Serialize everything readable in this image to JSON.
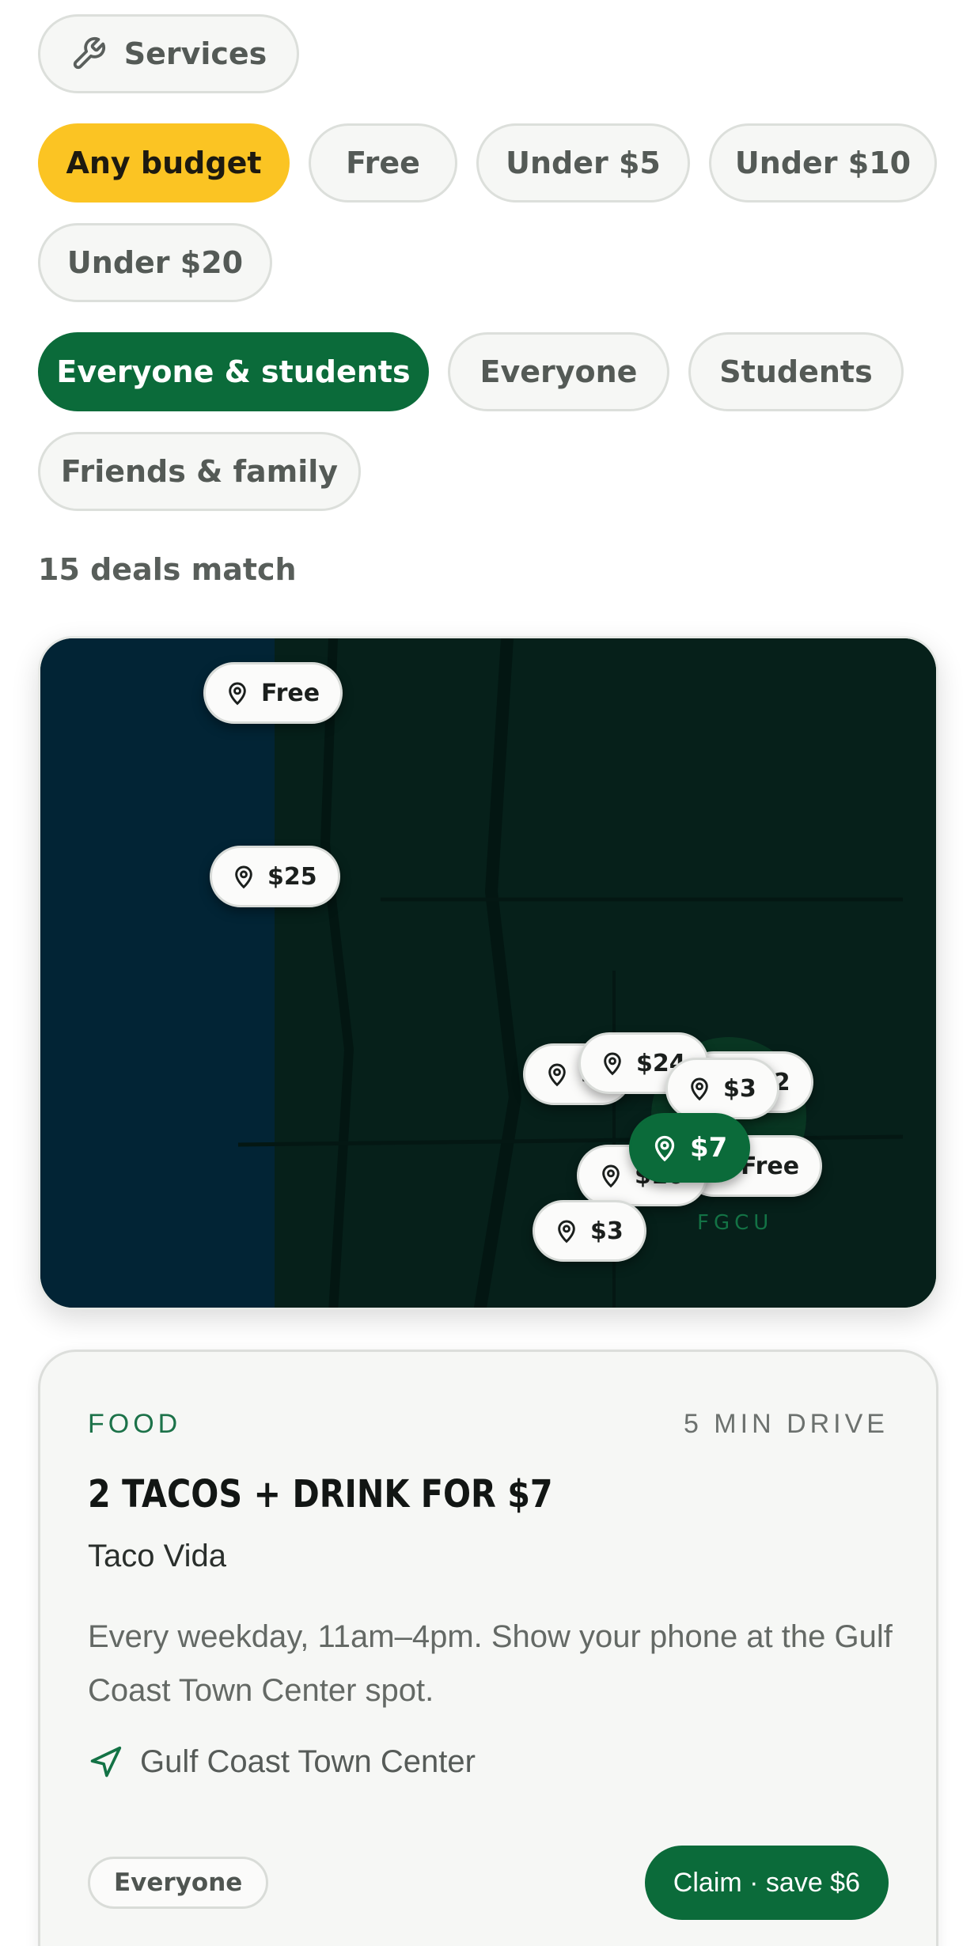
{
  "filters": {
    "category": {
      "label": "Services",
      "icon": "wrench-icon"
    },
    "budget": [
      "Any budget",
      "Free",
      "Under $5",
      "Under $10",
      "Under $20"
    ],
    "budget_selected": "Any budget",
    "audience": [
      "Everyone & students",
      "Everyone",
      "Students",
      "Friends & family"
    ],
    "audience_selected": "Everyone & students"
  },
  "results": {
    "count_text": "15 deals match"
  },
  "map": {
    "campus_label": "FGCU",
    "pins": [
      "Free",
      "$25",
      "$24",
      "$12",
      "$3",
      "$7",
      "Free",
      "$10",
      "$3",
      "$1"
    ],
    "active_pin": "$7",
    "colors": {
      "water": "#022435",
      "land": "#06201a",
      "active": "#0b6b3a"
    }
  },
  "deal": {
    "category": "FOOD",
    "drive_time": "5 MIN DRIVE",
    "title": "2 TACOS + DRINK FOR $7",
    "vendor": "Taco Vida",
    "description": "Every weekday, 11am–4pm. Show your phone at the Gulf Coast Town Center spot.",
    "location": "Gulf Coast Town Center",
    "location_icon": "navigation-arrow-icon",
    "audience": "Everyone",
    "claim_label": "Claim · save $6"
  },
  "colors": {
    "accent_green": "#0b6b3a",
    "accent_yellow": "#fbc423"
  }
}
